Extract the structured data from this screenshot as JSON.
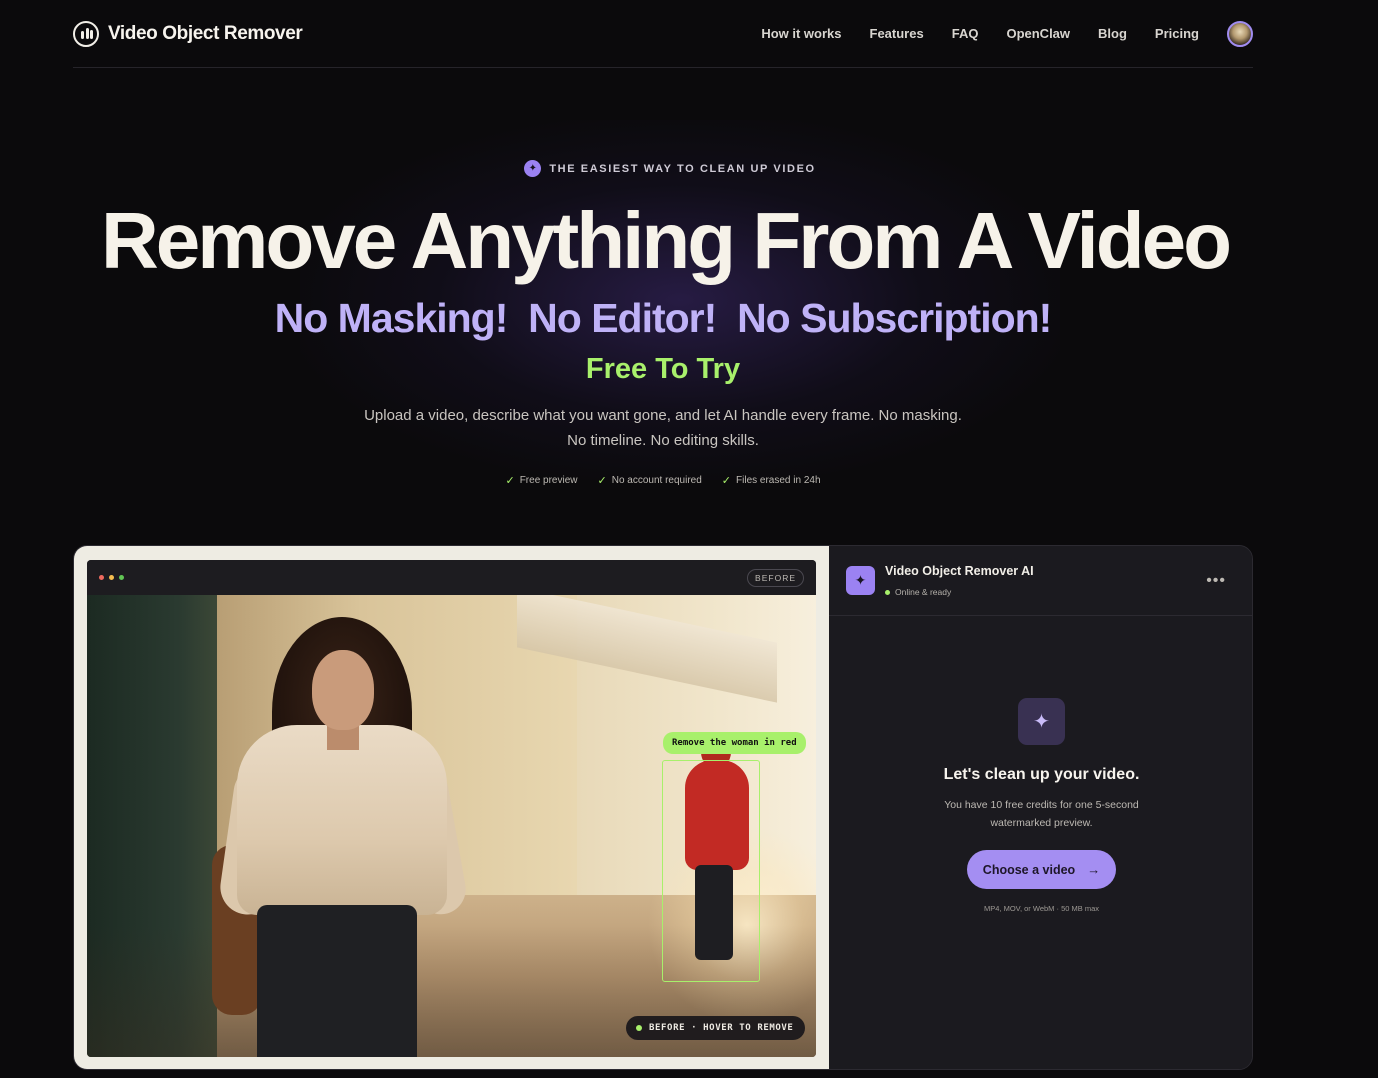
{
  "nav": {
    "brand": "Video Object Remover",
    "links": [
      "How it works",
      "Features",
      "FAQ",
      "OpenClaw",
      "Blog",
      "Pricing"
    ]
  },
  "hero": {
    "eyebrow": "THE EASIEST WAY TO CLEAN UP VIDEO",
    "title": "Remove Anything From A Video",
    "subtitle": "No Masking!  No Editor!  No Subscription!",
    "tagline": "Free To Try",
    "lead": "Upload a video, describe what you want gone, and let AI handle every frame. No masking. No timeline. No editing skills.",
    "checks": [
      "Free preview",
      "No account required",
      "Files erased in 24h"
    ]
  },
  "viewer": {
    "before_tag": "BEFORE",
    "prompt_chip": "Remove the woman in red",
    "status_chip": "BEFORE · HOVER TO REMOVE"
  },
  "assistant": {
    "name": "Video Object Remover AI",
    "status": "Online & ready",
    "empty_title": "Let's clean up your video.",
    "empty_sub": "You have 10 free credits for one 5-second watermarked preview.",
    "cta": "Choose a video",
    "formats": "MP4, MOV, or WebM · 50 MB max"
  },
  "colors": {
    "accent_purple": "#a48ef2",
    "accent_green": "#a8f06b",
    "background": "#0b0a0c"
  }
}
